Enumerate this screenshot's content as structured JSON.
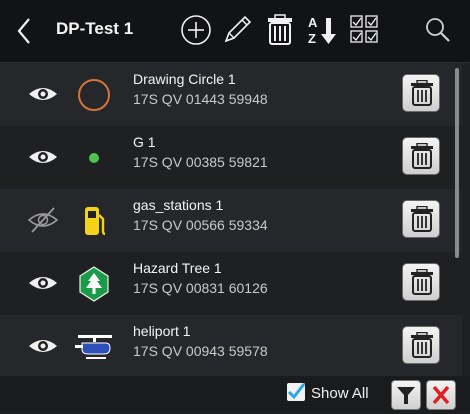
{
  "header": {
    "title": "DP-Test 1",
    "icons": [
      "back-chevron-icon",
      "add-circle-icon",
      "pencil-icon",
      "trash-icon",
      "sort-az-icon",
      "select-all-icon",
      "search-icon"
    ]
  },
  "items": [
    {
      "name": "Drawing Circle 1",
      "coord": "17S QV 01443 59948",
      "visible": true,
      "symbol": "orange-circle-outline-icon"
    },
    {
      "name": "G 1",
      "coord": "17S QV 00385 59821",
      "visible": true,
      "symbol": "green-dot-icon"
    },
    {
      "name": "gas_stations 1",
      "coord": "17S QV 00566 59334",
      "visible": false,
      "symbol": "gas-pump-icon"
    },
    {
      "name": "Hazard Tree 1",
      "coord": "17S QV 00831 60126",
      "visible": true,
      "symbol": "hazard-tree-icon"
    },
    {
      "name": "heliport 1",
      "coord": "17S QV 00943 59578",
      "visible": true,
      "symbol": "helicopter-icon"
    }
  ],
  "footer": {
    "show_all_label": "Show All",
    "show_all_checked": true
  },
  "colors": {
    "background": "#1f2022",
    "header": "#121314",
    "accent_blue": "#2aa7e8",
    "close_red": "#e02020",
    "circle_orange": "#d8733a",
    "dot_green": "#4fc34f",
    "gas_yellow": "#f3d31a",
    "tree_green": "#1b9b4a",
    "heli_blue": "#2c4fb8"
  }
}
